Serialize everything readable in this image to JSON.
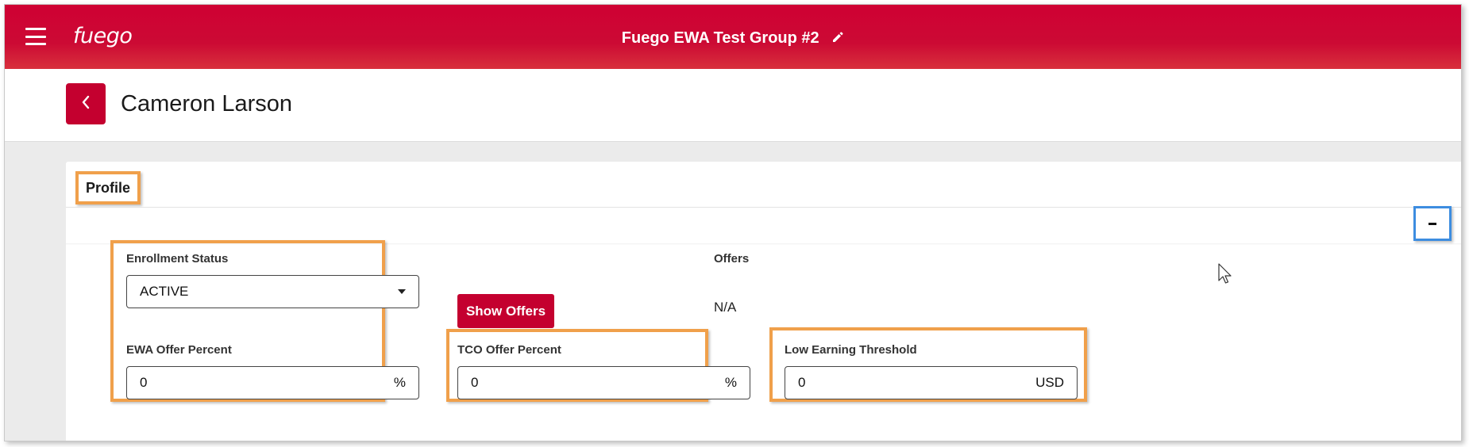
{
  "appbar": {
    "brand": "fuego",
    "group_title": "Fuego EWA Test Group #2",
    "menu_icon": "hamburger-menu-icon",
    "edit_icon": "pencil-icon"
  },
  "header": {
    "back_icon": "chevron-left-icon",
    "person_name": "Cameron Larson"
  },
  "card": {
    "tab_label": "Profile",
    "collapse_icon": "minus-icon"
  },
  "fields": {
    "enrollment_status": {
      "label": "Enrollment Status",
      "value": "ACTIVE"
    },
    "show_offers_label": "Show Offers",
    "offers": {
      "label": "Offers",
      "value": "N/A"
    },
    "ewa_offer_percent": {
      "label": "EWA Offer Percent",
      "value": "0",
      "suffix": "%"
    },
    "tco_offer_percent": {
      "label": "TCO Offer Percent",
      "value": "0",
      "suffix": "%"
    },
    "low_earning_threshold": {
      "label": "Low Earning Threshold",
      "value": "0",
      "suffix": "USD"
    }
  },
  "colors": {
    "brand_red": "#cc0a34",
    "highlight_orange": "#f0a04b",
    "highlight_blue": "#3d8de0"
  }
}
